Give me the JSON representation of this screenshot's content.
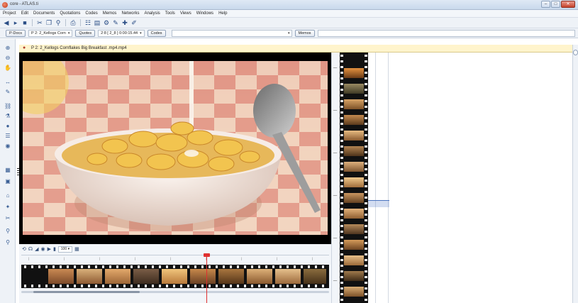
{
  "window": {
    "title": "core - ATLAS.ti",
    "buttons": {
      "minimize": "–",
      "maximize": "□",
      "close": "✕"
    }
  },
  "menu": [
    "Project",
    "Edit",
    "Documents",
    "Quotations",
    "Codes",
    "Memos",
    "Networks",
    "Analysis",
    "Tools",
    "Views",
    "Windows",
    "Help"
  ],
  "toolbar2": {
    "pdocs_label": "P-Docs",
    "pdoc_combo": "P 2: 2_Kellogs Corn",
    "quotes_label": "Quotes",
    "quote_combo": "2:8 [ 2_8 ] 0:00:15.44",
    "codes_label": "Codes",
    "memos_label": "Memos"
  },
  "document": {
    "title": "P 2: 2_Kellogs Cornflakes  Big Breakfast .mp4.mp4",
    "close": "×"
  },
  "media_controls": {
    "zoom_combo": "100 ▾"
  },
  "colors": {
    "titlebar": "#c9d9ec",
    "doc_header": "#fff4cc",
    "playhead": "#e03030",
    "video_bg": "#000000",
    "accent_blue": "#4a74bf"
  },
  "icons": {
    "app": "atlas-ti-app-icon",
    "toolbar": [
      "new-icon",
      "open-icon",
      "save-icon",
      "print-icon",
      "cut-icon",
      "copy-icon",
      "paste-icon",
      "find-icon",
      "network-icon",
      "pen-icon",
      "settings-icon"
    ],
    "left_tools": [
      "zoom-in-icon",
      "zoom-out-icon",
      "hand-icon",
      "code-icon",
      "memo-icon",
      "link-icon",
      "filter-icon",
      "color-icon",
      "list-icon",
      "grid-icon",
      "panel-icon",
      "magnify-icon"
    ],
    "media": [
      "loop-icon",
      "headphones-icon",
      "volume-icon",
      "camera-icon",
      "snapshot-icon"
    ]
  }
}
